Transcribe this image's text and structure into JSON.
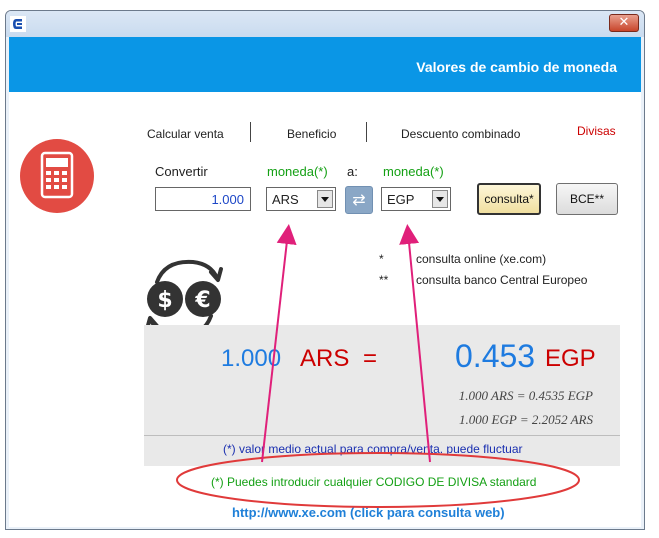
{
  "window": {
    "title": "",
    "close_glyph": "✕",
    "app_icon": "c-logo-icon"
  },
  "header": {
    "title": "Valores de cambio de moneda"
  },
  "tabs": [
    {
      "label": "Calcular venta"
    },
    {
      "label": "Beneficio"
    },
    {
      "label": "Descuento combinado"
    },
    {
      "label": "Divisas",
      "active": true
    }
  ],
  "form": {
    "convert_label": "Convertir",
    "from_currency_label": "moneda(*)",
    "to_label": "a:",
    "to_currency_label": "moneda(*)",
    "amount_value": "1.000",
    "from_currency": "ARS",
    "to_currency": "EGP",
    "swap_glyph": "⇄",
    "consulta_button": "consulta*",
    "bce_button": "BCE**"
  },
  "notes": {
    "star1_mark": "*",
    "star1_text": "consulta online (xe.com)",
    "star2_mark": "**",
    "star2_text": "consulta banco Central Europeo"
  },
  "result": {
    "from_amount": "1.000",
    "from_currency": "ARS",
    "equals": "=",
    "to_amount": "0.453",
    "to_currency": "EGP",
    "rate_line_1": "1.000 ARS  = 0.4535 EGP",
    "rate_line_2": "1.000 EGP  = 2.2052 ARS",
    "panel_note": "(*) valor medio actual para compra/venta. puede fluctuar"
  },
  "footer": {
    "hint": "(*) Puedes introducir cualquier CODIGO DE DIVISA standard",
    "link": "http://www.xe.com (click para consulta web)"
  },
  "colors": {
    "header_bg": "#0a96e6",
    "calc_icon_bg": "#e24b43",
    "annotation_arrow": "#e0207a",
    "annotation_ellipse": "#e03a3a"
  }
}
